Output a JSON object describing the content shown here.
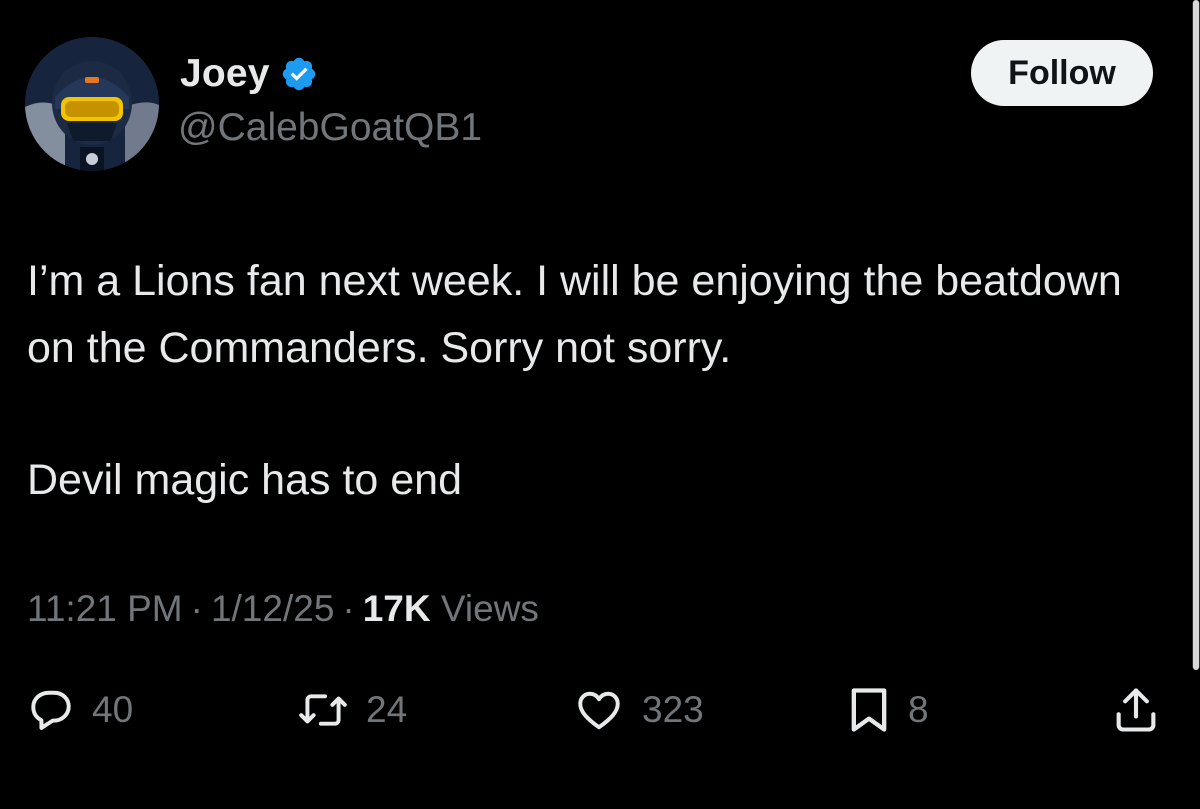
{
  "author": {
    "display_name": "Joey",
    "handle": "@CalebGoatQB1",
    "verified": true,
    "verified_color": "#1d9bf0"
  },
  "follow_button": {
    "label": "Follow"
  },
  "tweet": {
    "paragraphs": [
      "I’m a Lions fan next week. I will be enjoying the beatdown on the Commanders. Sorry not sorry.",
      "Devil magic has to end"
    ]
  },
  "meta": {
    "time": "11:21 PM",
    "date": "1/12/25",
    "views_count": "17K",
    "views_label": "Views",
    "separator": "·"
  },
  "actions": {
    "replies": {
      "icon": "reply-icon",
      "count": "40"
    },
    "reposts": {
      "icon": "repost-icon",
      "count": "24"
    },
    "likes": {
      "icon": "heart-icon",
      "count": "323"
    },
    "bookmarks": {
      "icon": "bookmark-icon",
      "count": "8"
    },
    "share": {
      "icon": "share-icon"
    }
  },
  "colors": {
    "background": "#000000",
    "primary_text": "#e7e9ea",
    "secondary_text": "#71767b",
    "follow_button_bg": "#eff3f4"
  }
}
